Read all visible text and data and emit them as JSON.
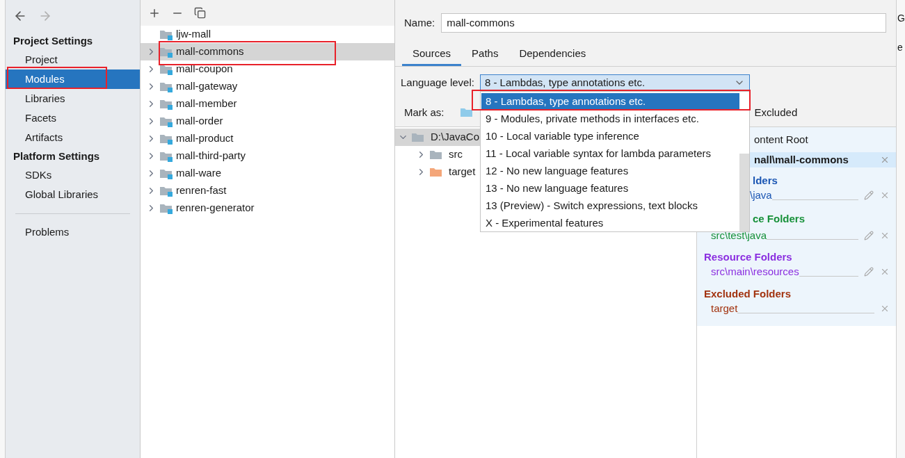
{
  "nav": [
    {
      "kind": "back",
      "disabled": false
    },
    {
      "kind": "forward",
      "disabled": true
    }
  ],
  "sidebar": {
    "sections": [
      {
        "title": "Project Settings",
        "items": [
          {
            "label": "Project",
            "selected": false
          },
          {
            "label": "Modules",
            "selected": true
          },
          {
            "label": "Libraries",
            "selected": false
          },
          {
            "label": "Facets",
            "selected": false
          },
          {
            "label": "Artifacts",
            "selected": false
          }
        ]
      },
      {
        "title": "Platform Settings",
        "items": [
          {
            "label": "SDKs",
            "selected": false
          },
          {
            "label": "Global Libraries",
            "selected": false
          }
        ]
      }
    ],
    "footer_items": [
      {
        "label": "Problems",
        "selected": false
      }
    ]
  },
  "modules": {
    "items": [
      {
        "label": "ljw-mall",
        "expandable": false,
        "selected": false
      },
      {
        "label": "mall-commons",
        "expandable": true,
        "selected": true
      },
      {
        "label": "mall-coupon",
        "expandable": true,
        "selected": false
      },
      {
        "label": "mall-gateway",
        "expandable": true,
        "selected": false
      },
      {
        "label": "mall-member",
        "expandable": true,
        "selected": false
      },
      {
        "label": "mall-order",
        "expandable": true,
        "selected": false
      },
      {
        "label": "mall-product",
        "expandable": true,
        "selected": false
      },
      {
        "label": "mall-third-party",
        "expandable": true,
        "selected": false
      },
      {
        "label": "mall-ware",
        "expandable": true,
        "selected": false
      },
      {
        "label": "renren-fast",
        "expandable": true,
        "selected": false
      },
      {
        "label": "renren-generator",
        "expandable": true,
        "selected": false
      }
    ]
  },
  "editor": {
    "name_label": "Name:",
    "name_value": "mall-commons",
    "tabs": [
      {
        "label": "Sources",
        "selected": true
      },
      {
        "label": "Paths",
        "selected": false
      },
      {
        "label": "Dependencies",
        "selected": false
      }
    ],
    "language_level": {
      "label": "Language level:",
      "value": "8 - Lambdas, type annotations etc.",
      "expanded": true,
      "options": [
        {
          "label": "8 - Lambdas, type annotations etc.",
          "selected": true
        },
        {
          "label": "9 - Modules, private methods in interfaces etc.",
          "selected": false
        },
        {
          "label": "10 - Local variable type inference",
          "selected": false
        },
        {
          "label": "11 - Local variable syntax for lambda parameters",
          "selected": false
        },
        {
          "label": "12 - No new language features",
          "selected": false
        },
        {
          "label": "13 - No new language features",
          "selected": false
        },
        {
          "label": "13 (Preview) - Switch expressions, text blocks",
          "selected": false
        },
        {
          "label": "X - Experimental features",
          "selected": false
        }
      ]
    },
    "mark_as": {
      "label": "Mark as:",
      "items": [
        {
          "kind": "sources"
        },
        {
          "label": "Excluded",
          "kind": "excluded"
        }
      ]
    },
    "file_tree": [
      {
        "label": "D:\\JavaCo",
        "kind": "folder",
        "expanded": true,
        "selected": true,
        "children": [
          {
            "label": "src",
            "kind": "folder",
            "expanded": false,
            "selected": false
          },
          {
            "label": "target",
            "kind": "excluded",
            "expanded": false,
            "selected": false
          }
        ]
      }
    ],
    "content_root": {
      "add_label": "ontent Root",
      "path": "nall\\mall-commons",
      "groups": [
        {
          "kind": "sources",
          "title": "lders",
          "path": "\\java",
          "editable": true
        },
        {
          "kind": "tests",
          "title": "ce Folders",
          "path": "src\\test\\java",
          "editable": true
        },
        {
          "kind": "resources",
          "title": "Resource Folders",
          "path": "src\\main\\resources",
          "editable": true
        },
        {
          "kind": "excluded",
          "title": "Excluded Folders",
          "path": "target",
          "editable": false
        }
      ]
    }
  },
  "right_edge": {
    "texts": [
      "G",
      "e"
    ]
  }
}
